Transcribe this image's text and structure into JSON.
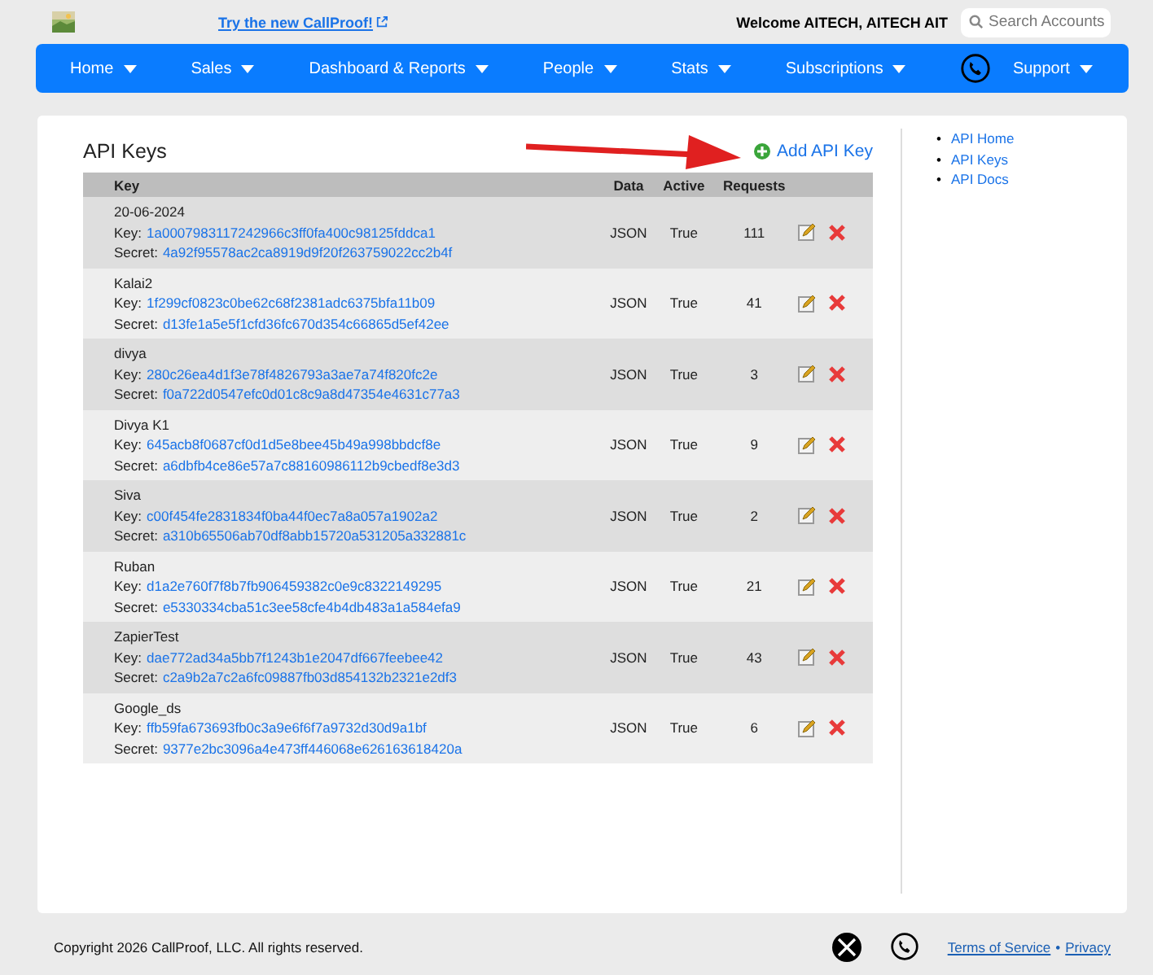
{
  "header": {
    "promo_link": "Try the new CallProof!",
    "welcome": "Welcome AITECH, AITECH AIT",
    "search": {
      "placeholder": "Search Accounts"
    }
  },
  "nav": [
    {
      "label": "Home",
      "kind": "menu"
    },
    {
      "label": "Sales",
      "kind": "menu"
    },
    {
      "label": "Dashboard & Reports",
      "kind": "menu"
    },
    {
      "label": "People",
      "kind": "menu"
    },
    {
      "label": "Stats",
      "kind": "menu"
    },
    {
      "label": "Subscriptions",
      "kind": "menu"
    },
    {
      "label": "Support",
      "kind": "phone-menu"
    }
  ],
  "page": {
    "title": "API Keys",
    "add_button": "Add API Key"
  },
  "table": {
    "columns": [
      "Key",
      "Data",
      "Active",
      "Requests"
    ],
    "rows": [
      {
        "name": "20-06-2024",
        "key_label": "Key:",
        "key": "1a0007983117242966c3ff0fa400c98125fddca1",
        "secret_label": "Secret:",
        "secret": "4a92f95578ac2ca8919d9f20f263759022cc2b4f",
        "data": "JSON",
        "active": "True",
        "requests": "111"
      },
      {
        "name": "Kalai2",
        "key_label": "Key:",
        "key": "1f299cf0823c0be62c68f2381adc6375bfa11b09",
        "secret_label": "Secret:",
        "secret": "d13fe1a5e5f1cfd36fc670d354c66865d5ef42ee",
        "data": "JSON",
        "active": "True",
        "requests": "41"
      },
      {
        "name": "divya",
        "key_label": "Key:",
        "key": "280c26ea4d1f3e78f4826793a3ae7a74f820fc2e",
        "secret_label": "Secret:",
        "secret": "f0a722d0547efc0d01c8c9a8d47354e4631c77a3",
        "data": "JSON",
        "active": "True",
        "requests": "3"
      },
      {
        "name": "Divya K1",
        "key_label": "Key:",
        "key": "645acb8f0687cf0d1d5e8bee45b49a998bbdcf8e",
        "secret_label": "Secret:",
        "secret": "a6dbfb4ce86e57a7c88160986112b9cbedf8e3d3",
        "data": "JSON",
        "active": "True",
        "requests": "9"
      },
      {
        "name": "Siva",
        "key_label": "Key:",
        "key": "c00f454fe2831834f0ba44f0ec7a8a057a1902a2",
        "secret_label": "Secret:",
        "secret": "a310b65506ab70df8abb15720a531205a332881c",
        "data": "JSON",
        "active": "True",
        "requests": "2"
      },
      {
        "name": "Ruban",
        "key_label": "Key:",
        "key": "d1a2e760f7f8b7fb906459382c0e9c8322149295",
        "secret_label": "Secret:",
        "secret": "e5330334cba51c3ee58cfe4b4db483a1a584efa9",
        "data": "JSON",
        "active": "True",
        "requests": "21"
      },
      {
        "name": "ZapierTest",
        "key_label": "Key:",
        "key": "dae772ad34a5bb7f1243b1e2047df667feebee42",
        "secret_label": "Secret:",
        "secret": "c2a9b2a7c2a6fc09887fb03d854132b2321e2df3",
        "data": "JSON",
        "active": "True",
        "requests": "43"
      },
      {
        "name": "Google_ds",
        "key_label": "Key:",
        "key": "ffb59fa673693fb0c3a9e6f6f7a9732d30d9a1bf",
        "secret_label": "Secret:",
        "secret": "9377e2bc3096a4e473ff446068e626163618420a",
        "data": "JSON",
        "active": "True",
        "requests": "6"
      }
    ]
  },
  "sidebar": {
    "links": [
      {
        "bullet": "•",
        "label": "API Home"
      },
      {
        "bullet": "•",
        "label": "API Keys"
      },
      {
        "bullet": "•",
        "label": "API Docs"
      }
    ]
  },
  "footer": {
    "copyright": "Copyright 2026 CallProof, LLC. All rights reserved.",
    "links": [
      "Terms of Service",
      "Privacy"
    ],
    "separator": "•"
  }
}
